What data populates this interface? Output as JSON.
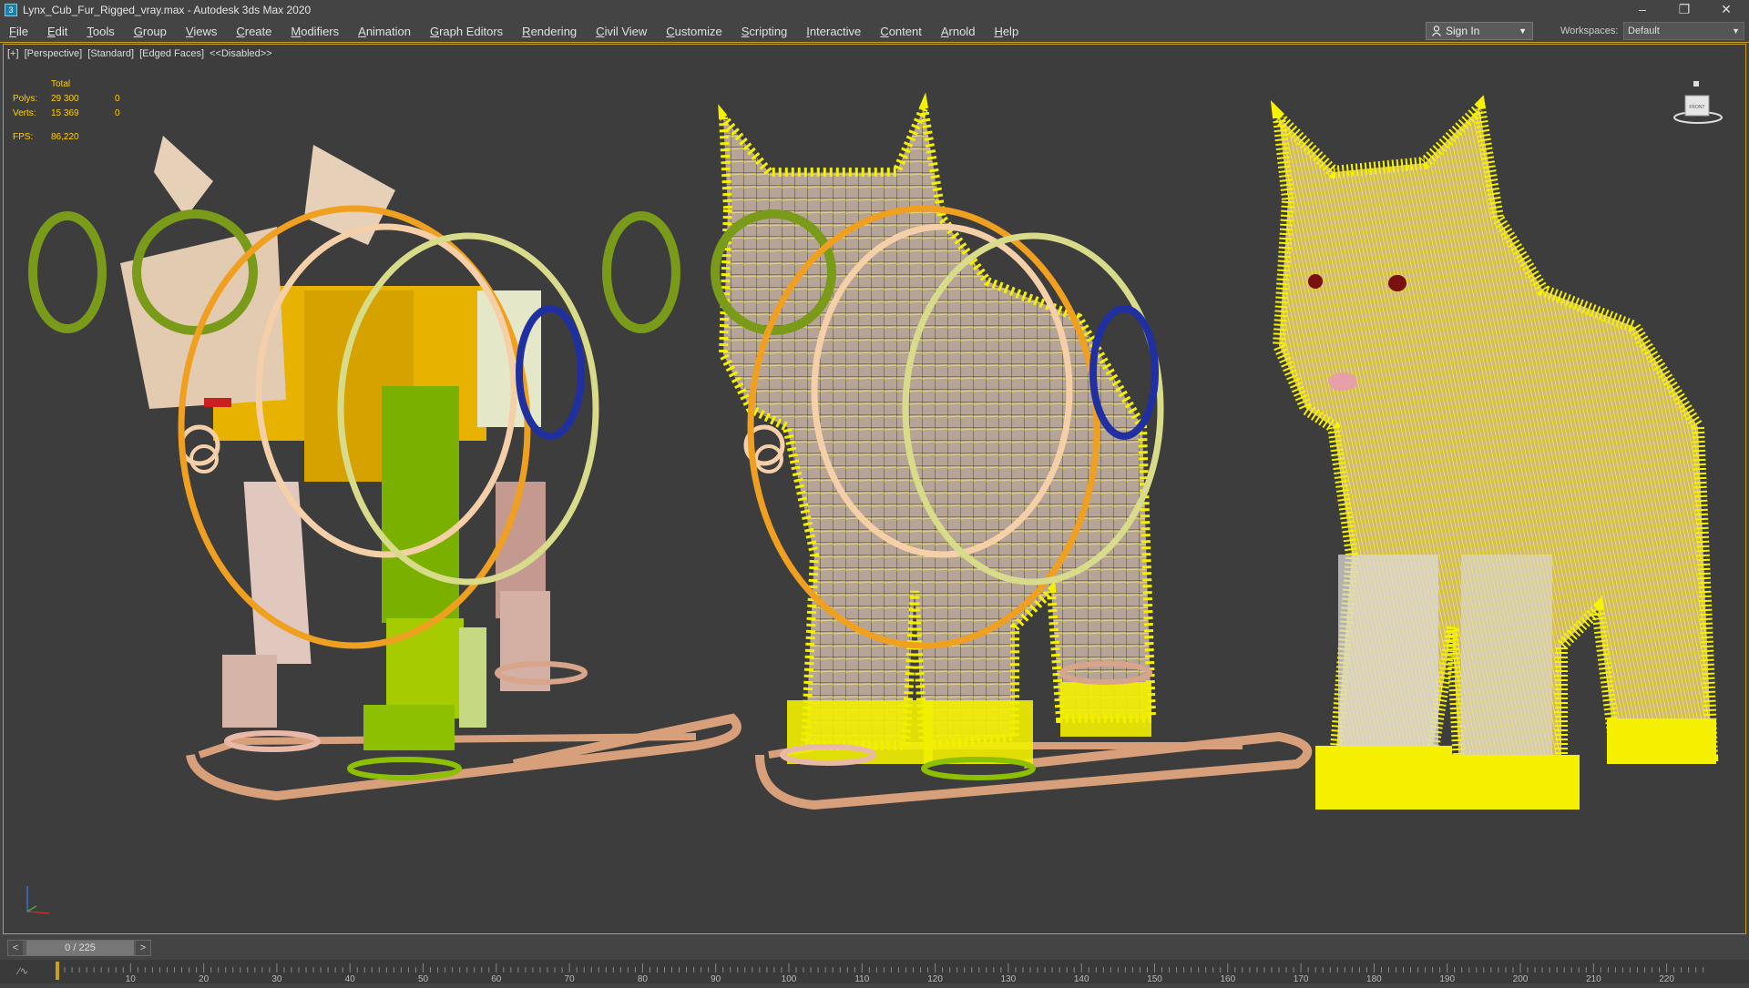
{
  "window": {
    "title": "Lynx_Cub_Fur_Rigged_vray.max - Autodesk 3ds Max 2020",
    "app_icon": "3ds-max-icon"
  },
  "window_controls": {
    "minimize": "–",
    "restore": "❐",
    "close": "✕"
  },
  "menu": [
    "File",
    "Edit",
    "Tools",
    "Group",
    "Views",
    "Create",
    "Modifiers",
    "Animation",
    "Graph Editors",
    "Rendering",
    "Civil View",
    "Customize",
    "Scripting",
    "Interactive",
    "Content",
    "Arnold",
    "Help"
  ],
  "signin": {
    "label": "Sign In"
  },
  "workspaces": {
    "label": "Workspaces:",
    "value": "Default"
  },
  "viewport": {
    "labels": [
      "[+]",
      "[Perspective]",
      "[Standard]",
      "[Edged Faces]",
      "<<Disabled>>"
    ],
    "stats": {
      "header": "Total",
      "polys_label": "Polys:",
      "polys_value": "29 300",
      "polys_sel": "0",
      "verts_label": "Verts:",
      "verts_value": "15 369",
      "verts_sel": "0",
      "fps_label": "FPS:",
      "fps_value": "86,220"
    },
    "viewcube_label": "FRONT",
    "colors": {
      "fur": "#f2f000",
      "ring_green": "#7a9a1a",
      "ring_orange": "#f0a020",
      "ring_beige": "#f5cfa8",
      "control_path": "#d4a078"
    }
  },
  "timeline": {
    "frame_display": "0 / 225",
    "prev": "<",
    "next": ">",
    "ticks": [
      "10",
      "20",
      "30",
      "40",
      "50",
      "60",
      "70",
      "80",
      "90",
      "100",
      "110",
      "120",
      "130",
      "140",
      "150",
      "160",
      "170",
      "180",
      "190",
      "200",
      "210",
      "220"
    ]
  }
}
